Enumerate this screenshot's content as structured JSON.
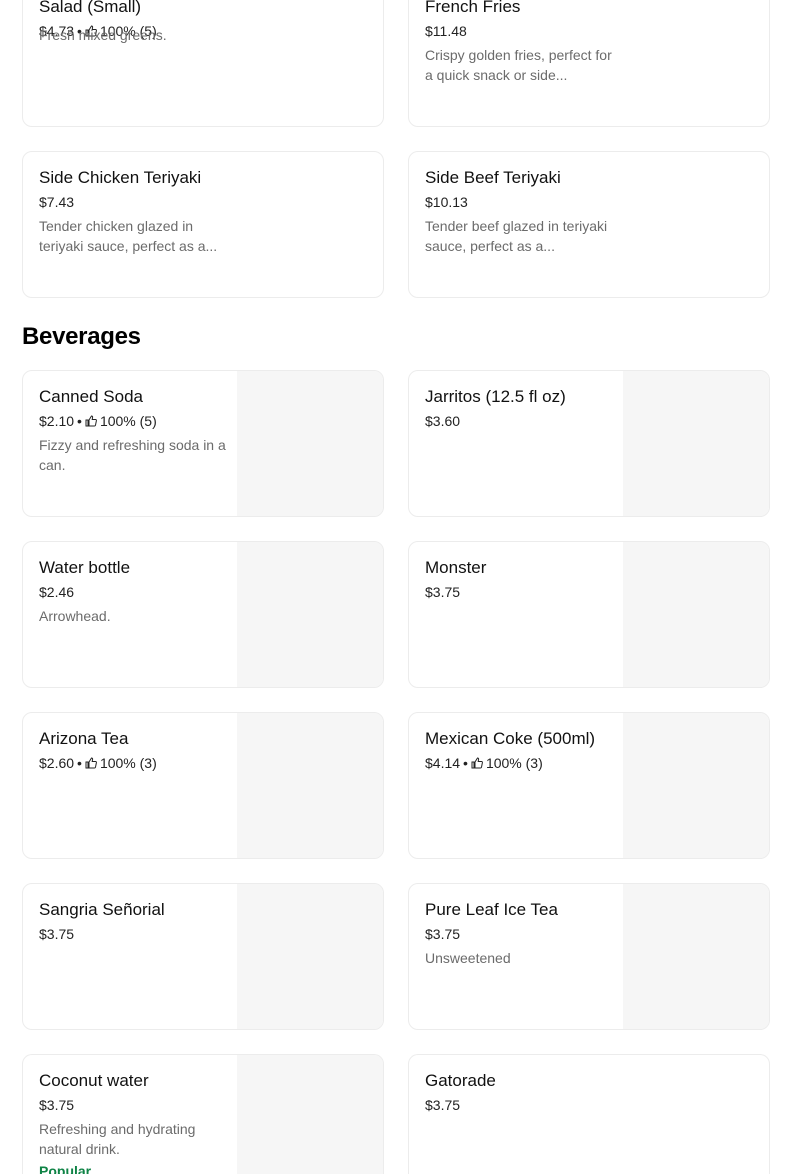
{
  "top_items": [
    {
      "name": "Salad (Small)",
      "price": "$4.73",
      "rating": "100% (5)",
      "description": "Fresh mixed greens."
    },
    {
      "name": "French Fries",
      "price": "$11.48",
      "rating": "",
      "description": "Crispy golden fries, perfect for a quick snack or side..."
    },
    {
      "name": "Side Chicken Teriyaki",
      "price": "$7.43",
      "rating": "",
      "description": "Tender chicken glazed in teriyaki sauce, perfect as a..."
    },
    {
      "name": "Side Beef Teriyaki",
      "price": "$10.13",
      "rating": "",
      "description": "Tender beef glazed in teriyaki sauce, perfect as a..."
    }
  ],
  "beverages": {
    "title": "Beverages",
    "items": [
      {
        "name": "Canned Soda",
        "price": "$2.10",
        "rating": "100% (5)",
        "description": "Fizzy and refreshing soda in a can."
      },
      {
        "name": "Jarritos (12.5 fl oz)",
        "price": "$3.60",
        "rating": "",
        "description": ""
      },
      {
        "name": "Water bottle",
        "price": "$2.46",
        "rating": "",
        "description": "Arrowhead."
      },
      {
        "name": "Monster",
        "price": "$3.75",
        "rating": "",
        "description": ""
      },
      {
        "name": "Arizona Tea",
        "price": "$2.60",
        "rating": "100% (3)",
        "description": ""
      },
      {
        "name": "Mexican Coke (500ml)",
        "price": "$4.14",
        "rating": "100% (3)",
        "description": ""
      },
      {
        "name": "Sangria Señorial",
        "price": "$3.75",
        "rating": "",
        "description": ""
      },
      {
        "name": "Pure Leaf Ice Tea",
        "price": "$3.75",
        "rating": "",
        "description": "Unsweetened"
      },
      {
        "name": "Coconut water",
        "price": "$3.75",
        "rating": "",
        "description": "Refreshing and hydrating natural drink.",
        "badge": "Popular"
      },
      {
        "name": "Gatorade",
        "price": "$3.75",
        "rating": "",
        "description": ""
      }
    ]
  },
  "separator": "•",
  "icons": {
    "rating": "thumbs-up-icon"
  },
  "colors": {
    "popular_badge": "#0e8345",
    "image_placeholder": "#f6f6f6",
    "card_border": "#ececec"
  }
}
